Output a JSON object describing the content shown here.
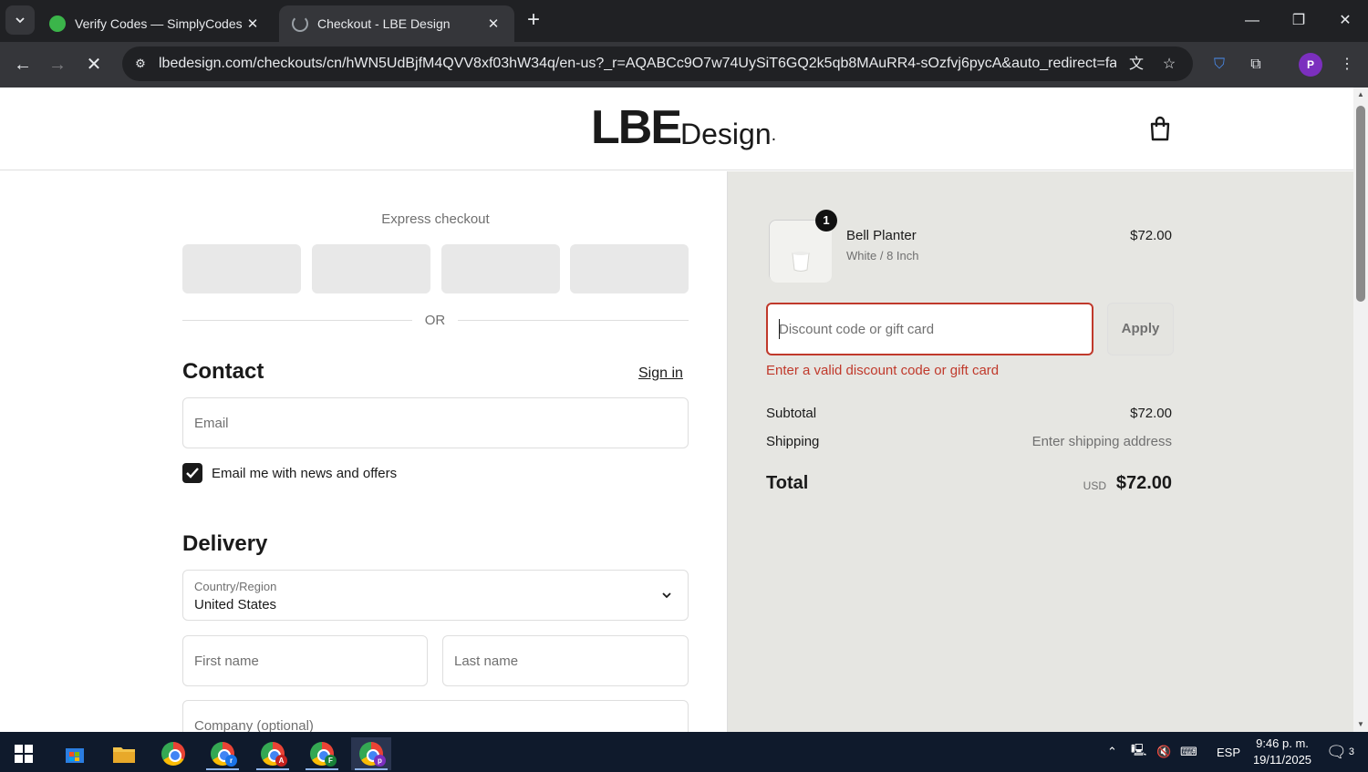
{
  "browser": {
    "tabs": [
      {
        "title": "Verify Codes — SimplyCodes",
        "active": false
      },
      {
        "title": "Checkout - LBE Design",
        "active": true
      }
    ],
    "url": "lbedesign.com/checkouts/cn/hWN5UdBjfM4QVV8xf03hW34q/en-us?_r=AQABCc9O7w74UySiT6GQ2k5qb8MAuRR4-sOzfvj6pycA&auto_redirect=false&e...",
    "profile_initial": "P"
  },
  "logo": {
    "bold": "LBE",
    "light": "Design",
    "dot": "."
  },
  "checkout": {
    "express_title": "Express checkout",
    "or": "OR",
    "contact_title": "Contact",
    "sign_in": "Sign in",
    "email_placeholder": "Email",
    "newsletter_label": "Email me with news and offers",
    "newsletter_checked": true,
    "delivery_title": "Delivery",
    "country_label": "Country/Region",
    "country_value": "United States",
    "first_name_placeholder": "First name",
    "last_name_placeholder": "Last name",
    "company_placeholder": "Company (optional)"
  },
  "summary": {
    "quantity_badge": "1",
    "product_name": "Bell Planter",
    "product_variant": "White / 8 Inch",
    "product_price": "$72.00",
    "discount_placeholder": "Discount code or gift card",
    "apply_label": "Apply",
    "error_text": "Enter a valid discount code or gift card",
    "subtotal_label": "Subtotal",
    "subtotal_value": "$72.00",
    "shipping_label": "Shipping",
    "shipping_value": "Enter shipping address",
    "total_label": "Total",
    "total_currency": "USD",
    "total_value": "$72.00"
  },
  "taskbar": {
    "apps": [
      {
        "icon": "store-icon"
      },
      {
        "icon": "file-explorer-icon"
      },
      {
        "icon": "chrome-icon"
      },
      {
        "icon": "chrome-profile-r-icon",
        "badge": "r"
      },
      {
        "icon": "chrome-profile-a-icon",
        "badge": "A"
      },
      {
        "icon": "chrome-profile-f-icon",
        "badge": "F"
      },
      {
        "icon": "chrome-profile-p-icon",
        "badge": "p"
      }
    ],
    "language": "ESP",
    "time": "9:46 p. m.",
    "date": "19/11/2025",
    "notification_count": "3"
  },
  "colors": {
    "error": "#c0392b",
    "summary_bg": "#e6e6e2",
    "chrome_dark": "#202124",
    "taskbar": "#0f1a2c"
  }
}
